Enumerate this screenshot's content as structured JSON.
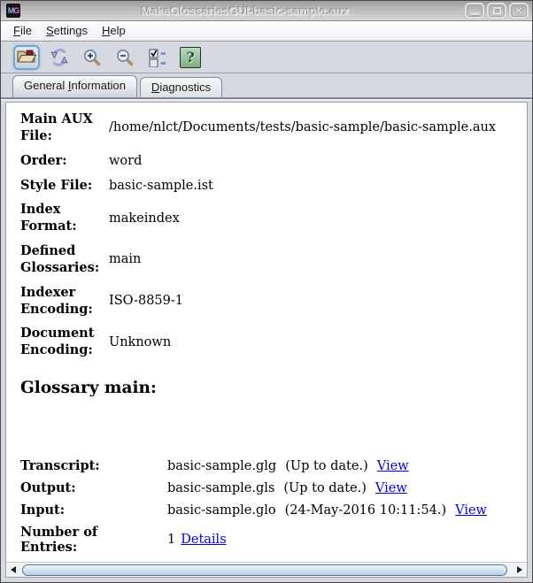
{
  "titlebar": {
    "title": "MakeGlossariesGUI-basic-sample.aux",
    "icon_m": "M",
    "icon_g": "G"
  },
  "window_controls": {
    "close_glyph": "✕"
  },
  "menu": {
    "items": [
      {
        "pre": "",
        "key": "F",
        "rest": "ile"
      },
      {
        "pre": "",
        "key": "S",
        "rest": "ettings"
      },
      {
        "pre": "",
        "key": "H",
        "rest": "elp"
      }
    ]
  },
  "toolbar": {
    "icons": [
      "open-file",
      "reload",
      "zoom-in",
      "zoom-out",
      "diagnostic-options",
      "help"
    ],
    "help_glyph": "?"
  },
  "tabs": [
    {
      "pre": "General ",
      "key": "I",
      "rest": "nformation",
      "selected": true
    },
    {
      "pre": "",
      "key": "D",
      "rest": "iagnostics",
      "selected": false
    }
  ],
  "general_info": {
    "fields": [
      {
        "label": "Main AUX File:",
        "value": "/home/nlct/Documents/tests/basic-sample/basic-sample.aux"
      },
      {
        "label": "Order:",
        "value": "word"
      },
      {
        "label": "Style File:",
        "value": "basic-sample.ist"
      },
      {
        "label": "Index Format:",
        "value": "makeindex"
      },
      {
        "label": "Defined Glossaries:",
        "value": "main"
      },
      {
        "label": "Indexer Encoding:",
        "value": "ISO-8859-1"
      },
      {
        "label": "Document Encoding:",
        "value": "Unknown"
      }
    ],
    "glossary_heading": "Glossary main:",
    "glossary": {
      "rows": [
        {
          "label": "Transcript:",
          "file": "basic-sample.glg",
          "status": "(Up to date.)",
          "link": "View"
        },
        {
          "label": "Output:",
          "file": "basic-sample.gls",
          "status": "(Up to date.)",
          "link": "View"
        },
        {
          "label": "Input:",
          "file": "basic-sample.glo",
          "status": "(24-May-2016 10:11:54.)",
          "link": "View"
        }
      ],
      "entries": {
        "label": "Number of Entries:",
        "value": "1",
        "link": "Details"
      }
    }
  },
  "colors": {
    "link": "#0000ee",
    "toolbar_bg": "#d6d9df",
    "help_green": "#8fbc95"
  }
}
